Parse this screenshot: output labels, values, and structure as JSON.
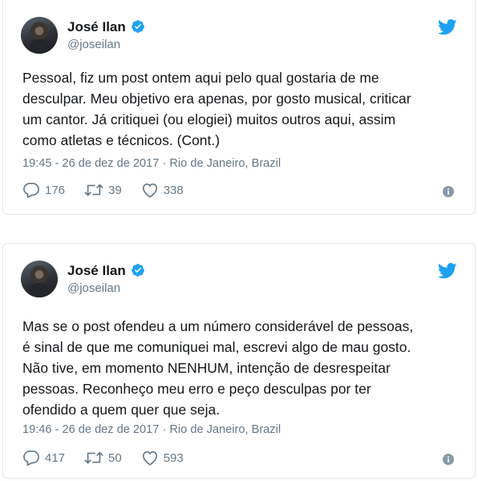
{
  "tweets": [
    {
      "display_name": "José Ilan",
      "handle": "@joseilan",
      "text_lines": [
        "Pessoal, fiz um post ontem aqui pelo qual gostaria de me",
        "desculpar. Meu objetivo era apenas, por gosto musical, criticar",
        "um cantor. Já critiquei (ou elogiei) muitos outros aqui, assim",
        "como atletas e técnicos. (Cont.)"
      ],
      "meta": "19:45 - 26 de dez de 2017 · Rio de Janeiro, Brazil",
      "replies": "176",
      "retweets": "39",
      "likes": "338"
    },
    {
      "display_name": "José Ilan",
      "handle": "@joseilan",
      "text_lines": [
        "Mas se o post ofendeu a um número considerável de pessoas,",
        "é sinal de que me comuniquei mal, escrevi algo de mau gosto.",
        "Não tive, em momento NENHUM, intenção de desrespeitar",
        "pessoas. Reconheço meu erro e peço desculpas por ter",
        "ofendido a quem quer que seja."
      ],
      "meta": "19:46 - 26 de dez de 2017 · Rio de Janeiro, Brazil",
      "replies": "417",
      "retweets": "50",
      "likes": "593"
    }
  ],
  "icons": {
    "verified": "verified-badge-icon",
    "brand": "twitter-bird-icon",
    "reply": "reply-icon",
    "retweet": "retweet-icon",
    "like": "heart-icon",
    "info": "info-icon"
  },
  "colors": {
    "brand_blue": "#1da1f2",
    "text": "#14171a",
    "muted": "#657786",
    "border": "#e1e8ed"
  }
}
